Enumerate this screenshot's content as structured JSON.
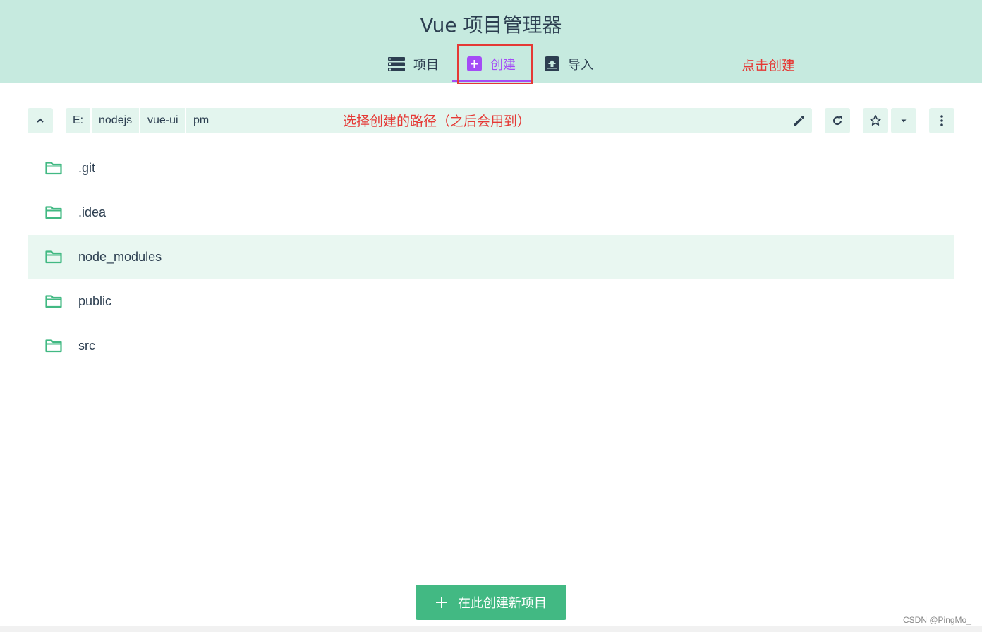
{
  "header": {
    "title": "Vue 项目管理器",
    "tabs": [
      {
        "label": "项目",
        "icon": "list-icon"
      },
      {
        "label": "创建",
        "icon": "plus-box-icon",
        "active": true
      },
      {
        "label": "导入",
        "icon": "import-icon"
      }
    ]
  },
  "annotations": {
    "create_hint": "点击创建",
    "path_hint": "选择创建的路径（之后会用到）"
  },
  "path": {
    "segments": [
      "E:",
      "nodejs",
      "vue-ui",
      "pm"
    ]
  },
  "folders": [
    ".git",
    ".idea",
    "node_modules",
    "public",
    "src"
  ],
  "actions": {
    "create_here": "在此创建新项目"
  },
  "watermark": "CSDN @PingMo_",
  "colors": {
    "header_bg": "#c6eadf",
    "accent_purple": "#a44cf6",
    "brand_green": "#42b983",
    "annotation_red": "#e53935",
    "text": "#2c3e50"
  }
}
